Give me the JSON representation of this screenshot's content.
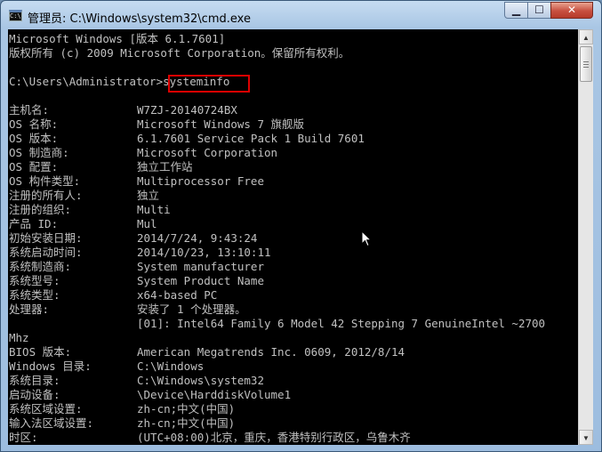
{
  "window": {
    "title": "管理员: C:\\Windows\\system32\\cmd.exe",
    "icon": "cmd-icon",
    "controls": {
      "minimize": "minimize-icon",
      "maximize": "maximize-icon",
      "close": "close-icon"
    }
  },
  "console": {
    "header": [
      "Microsoft Windows [版本 6.1.7601]",
      "版权所有 (c) 2009 Microsoft Corporation。保留所有权利。"
    ],
    "prompt": "C:\\Users\\Administrator>",
    "command": "systeminfo",
    "rows": [
      {
        "key": "主机名:",
        "value": "W7ZJ-20140724BX"
      },
      {
        "key": "OS 名称:",
        "value": "Microsoft Windows 7 旗舰版"
      },
      {
        "key": "OS 版本:",
        "value": "6.1.7601 Service Pack 1 Build 7601"
      },
      {
        "key": "OS 制造商:",
        "value": "Microsoft Corporation"
      },
      {
        "key": "OS 配置:",
        "value": "独立工作站"
      },
      {
        "key": "OS 构件类型:",
        "value": "Multiprocessor Free"
      },
      {
        "key": "注册的所有人:",
        "value": "独立"
      },
      {
        "key": "注册的组织:",
        "value": "Multi"
      },
      {
        "key": "产品 ID:",
        "value": "Mul"
      },
      {
        "key": "初始安装日期:",
        "value": "2014/7/24, 9:43:24"
      },
      {
        "key": "系统启动时间:",
        "value": "2014/10/23, 13:10:11"
      },
      {
        "key": "系统制造商:",
        "value": "System manufacturer"
      },
      {
        "key": "系统型号:",
        "value": "System Product Name"
      },
      {
        "key": "系统类型:",
        "value": "x64-based PC"
      },
      {
        "key": "处理器:",
        "value": "安装了 1 个处理器。"
      },
      {
        "key": "",
        "value": "[01]: Intel64 Family 6 Model 42 Stepping 7 GenuineIntel ~2700"
      },
      {
        "key": "Mhz",
        "value": ""
      },
      {
        "key": "BIOS 版本:",
        "value": "American Megatrends Inc. 0609, 2012/8/14"
      },
      {
        "key": "Windows 目录:",
        "value": "C:\\Windows"
      },
      {
        "key": "系统目录:",
        "value": "C:\\Windows\\system32"
      },
      {
        "key": "启动设备:",
        "value": "\\Device\\HarddiskVolume1"
      },
      {
        "key": "系统区域设置:",
        "value": "zh-cn;中文(中国)"
      },
      {
        "key": "输入法区域设置:",
        "value": "zh-cn;中文(中国)"
      },
      {
        "key": "时区:",
        "value": "(UTC+08:00)北京，重庆，香港特别行政区，乌鲁木齐"
      }
    ]
  },
  "scrollbar": {
    "up": "scroll-up-arrow-icon",
    "down": "scroll-down-arrow-icon"
  },
  "colors": {
    "console_bg": "#000000",
    "console_text": "#c0c0c0",
    "highlight_border": "#dd0000"
  }
}
